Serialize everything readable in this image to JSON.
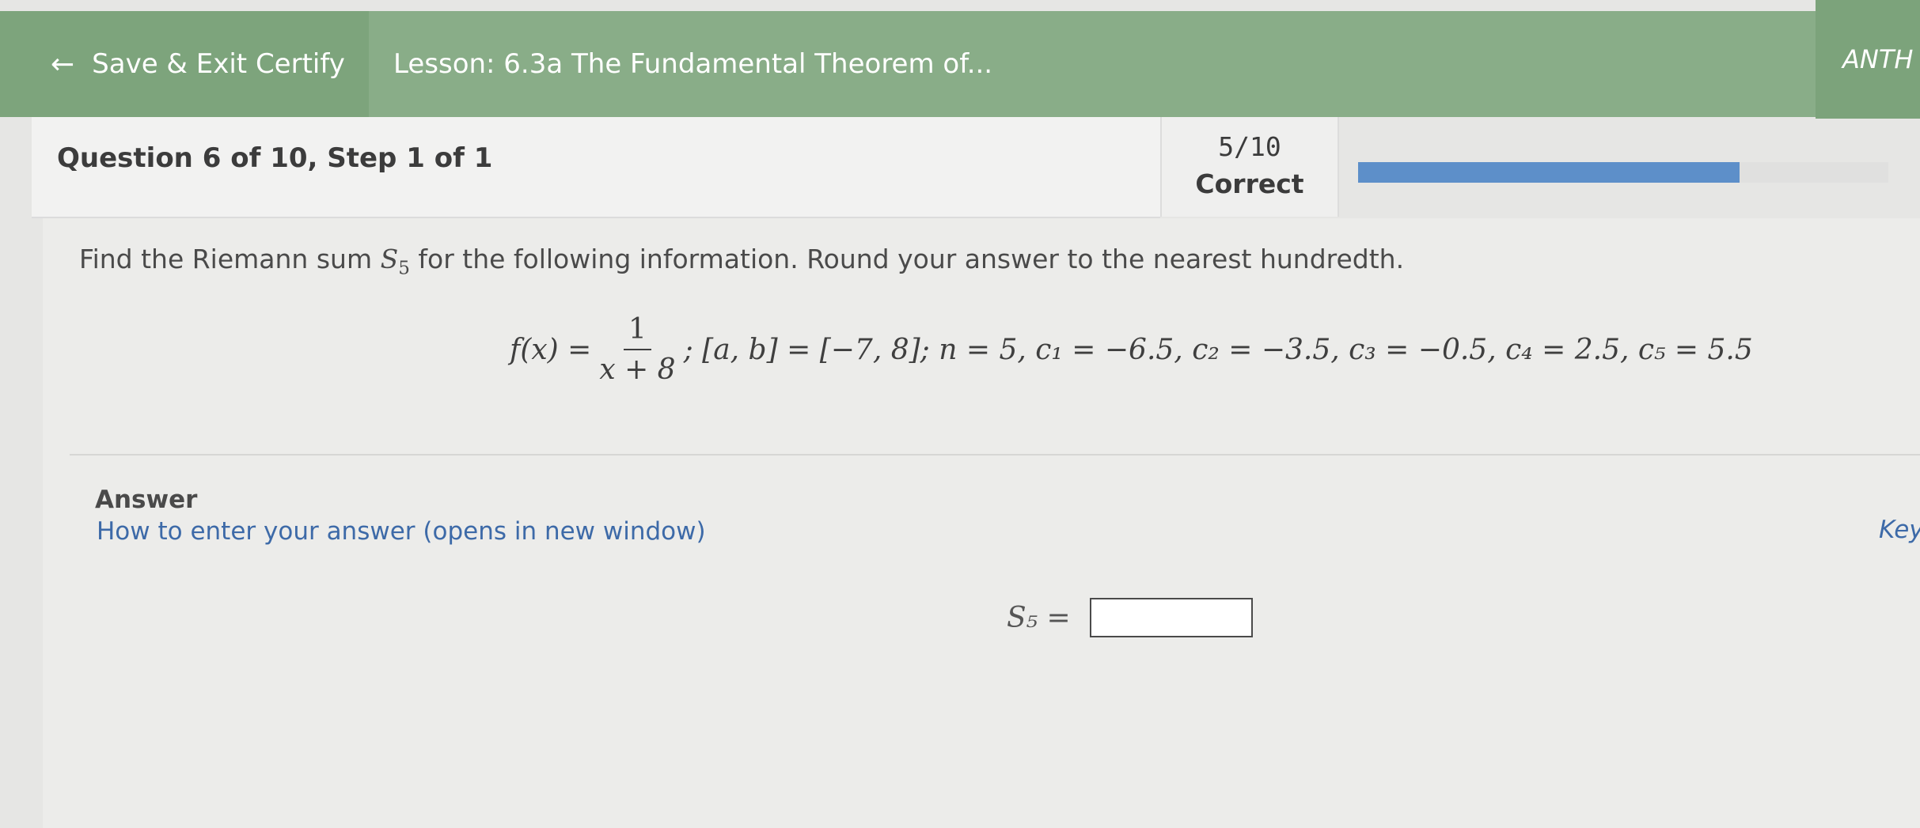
{
  "header": {
    "back_label": "Save & Exit Certify",
    "lesson_title": "Lesson: 6.3a The Fundamental Theorem of...",
    "brand": "ANTH"
  },
  "question": {
    "title": "Question 6 of 10, Step 1 of 1",
    "score_fraction": "5/10",
    "score_label": "Correct",
    "progress": 0.72
  },
  "problem": {
    "prompt_before": "Find the Riemann sum",
    "prompt_symbol": "S",
    "prompt_subscript": "5",
    "prompt_after": "for the following information. Round your answer to the nearest hundredth.",
    "func_lhs": "f(x) =",
    "func_numerator": "1",
    "func_denominator": "x + 8",
    "conditions": "; [a, b] = [−7, 8]; n = 5, c₁ = −6.5, c₂ = −3.5, c₃ = −0.5, c₄ = 2.5, c₅ = 5.5"
  },
  "answer": {
    "label": "Answer",
    "help_link": "How to enter your answer (opens in new window)",
    "keyboard_link": "Keyb",
    "symbol": "S₅ =",
    "input_value": ""
  },
  "colors": {
    "header_green": "#89ad88",
    "progress_blue": "#5d8fc9",
    "link_blue": "#3d6aa8"
  }
}
